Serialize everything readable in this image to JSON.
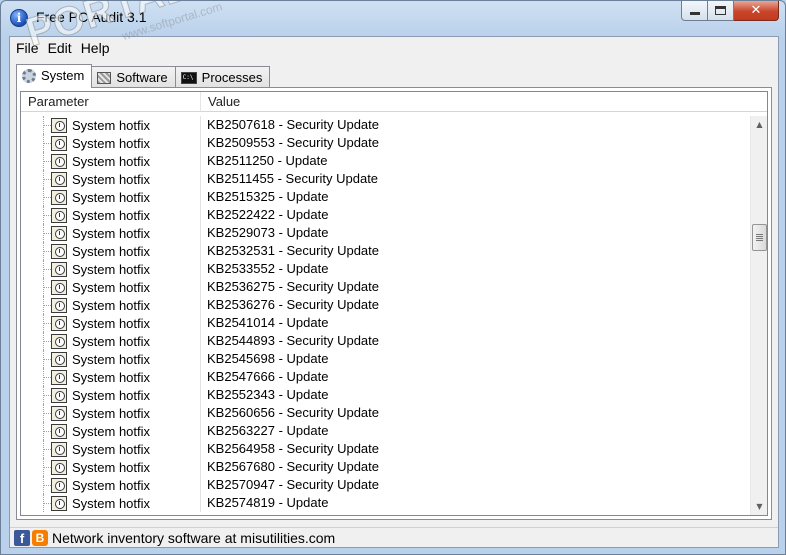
{
  "window": {
    "title": "Free PC Audit 3.1",
    "accent_color": "#c9452a"
  },
  "menu": {
    "items": [
      {
        "label": "File"
      },
      {
        "label": "Edit"
      },
      {
        "label": "Help"
      }
    ]
  },
  "tabs": [
    {
      "label": "System",
      "icon": "gear-icon",
      "active": true
    },
    {
      "label": "Software",
      "icon": "software-icon",
      "active": false
    },
    {
      "label": "Processes",
      "icon": "console-icon",
      "active": false
    }
  ],
  "list": {
    "columns": {
      "parameter": "Parameter",
      "value": "Value"
    },
    "rows": [
      {
        "parameter": "System hotfix",
        "value": "KB2507618 - Security Update"
      },
      {
        "parameter": "System hotfix",
        "value": "KB2509553 - Security Update"
      },
      {
        "parameter": "System hotfix",
        "value": "KB2511250 - Update"
      },
      {
        "parameter": "System hotfix",
        "value": "KB2511455 - Security Update"
      },
      {
        "parameter": "System hotfix",
        "value": "KB2515325 - Update"
      },
      {
        "parameter": "System hotfix",
        "value": "KB2522422 - Update"
      },
      {
        "parameter": "System hotfix",
        "value": "KB2529073 - Update"
      },
      {
        "parameter": "System hotfix",
        "value": "KB2532531 - Security Update"
      },
      {
        "parameter": "System hotfix",
        "value": "KB2533552 - Update"
      },
      {
        "parameter": "System hotfix",
        "value": "KB2536275 - Security Update"
      },
      {
        "parameter": "System hotfix",
        "value": "KB2536276 - Security Update"
      },
      {
        "parameter": "System hotfix",
        "value": "KB2541014 - Update"
      },
      {
        "parameter": "System hotfix",
        "value": "KB2544893 - Security Update"
      },
      {
        "parameter": "System hotfix",
        "value": "KB2545698 - Update"
      },
      {
        "parameter": "System hotfix",
        "value": "KB2547666 - Update"
      },
      {
        "parameter": "System hotfix",
        "value": "KB2552343 - Update"
      },
      {
        "parameter": "System hotfix",
        "value": "KB2560656 - Security Update"
      },
      {
        "parameter": "System hotfix",
        "value": "KB2563227 - Update"
      },
      {
        "parameter": "System hotfix",
        "value": "KB2564958 - Security Update"
      },
      {
        "parameter": "System hotfix",
        "value": "KB2567680 - Security Update"
      },
      {
        "parameter": "System hotfix",
        "value": "KB2570947 - Security Update"
      },
      {
        "parameter": "System hotfix",
        "value": "KB2574819 - Update"
      }
    ]
  },
  "status": {
    "text": "Network inventory software at misutilities.com",
    "facebook_icon": "f",
    "blogger_icon": "B"
  },
  "watermark": {
    "main": "PORTAL",
    "sub": "www.softportal.com"
  }
}
